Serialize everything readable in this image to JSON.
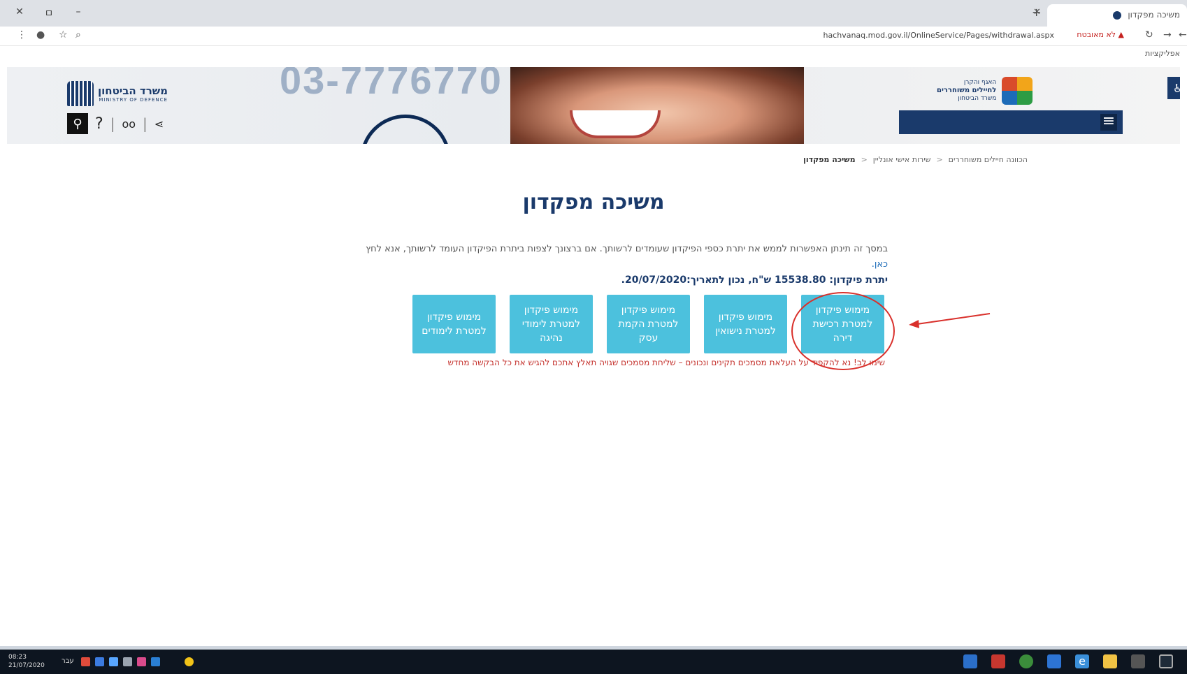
{
  "browser": {
    "window_controls": {
      "close": "✕",
      "maximize": "ㅁ",
      "minimize": "–"
    },
    "tab": {
      "title": "משיכה מפקדון",
      "close_icon": "✕",
      "new_tab_icon": "+"
    },
    "address_bar": {
      "url": "hachvanaq.mod.gov.il/OnlineService/Pages/withdrawal.aspx",
      "security_warning": "לא מאובטח",
      "warning_color": "#c5221f"
    },
    "bookmarks_bar": {
      "item": "אפליקציות"
    }
  },
  "header": {
    "ministry_logo": {
      "hebrew": "משרד הביטחון",
      "english": "MINISTRY OF DEFENCE"
    },
    "banner_phone": "03-7776770",
    "department_logo": {
      "line1": "האגף והקרן",
      "line2": "לחיילים משוחררים",
      "line3": "משרד הביטחון"
    },
    "icons": [
      "search-icon",
      "help-icon",
      "glasses-icon",
      "share-icon",
      "accessibility-icon",
      "menu-icon"
    ],
    "brand_color": "#1a3a6b"
  },
  "breadcrumb": {
    "items": [
      "הכוונה חיילים משוחררים",
      "שירות אישי אונליין",
      "משיכה מפקדון"
    ],
    "separator": "<"
  },
  "main": {
    "title": "משיכה מפקדון",
    "intro": "במסך זה תינתן האפשרות לממש את יתרת כספי הפיקדון שעומדים לרשותך. אם ברצונך לצפות ביתרת הפיקדון העומד לרשותך, אנא לחץ",
    "intro_link": "כאן.",
    "balance": "יתרת פיקדון: 15538.80 ש\"ח, נכון לתאריך:20/07/2020.",
    "buttons": [
      "מימוש פיקדון למטרת לימודים",
      "מימוש פיקדון למטרת לימודי נהיגה",
      "מימוש פיקדון למטרת הקמת עסק",
      "מימוש פיקדון למטרת נישואין",
      "מימוש פיקדון למטרת רכישת דירה"
    ],
    "button_color": "#4cc1dd",
    "warning": "שימו לב! נא להקפיד על העלאת מסמכים תקינים ונכונים – שליחת מסמכים שגויה תאלץ אתכם להגיש את כל הבקשה מחדש"
  },
  "taskbar": {
    "clock_time": "08:23",
    "clock_date": "21/07/2020",
    "language": "עבר"
  }
}
